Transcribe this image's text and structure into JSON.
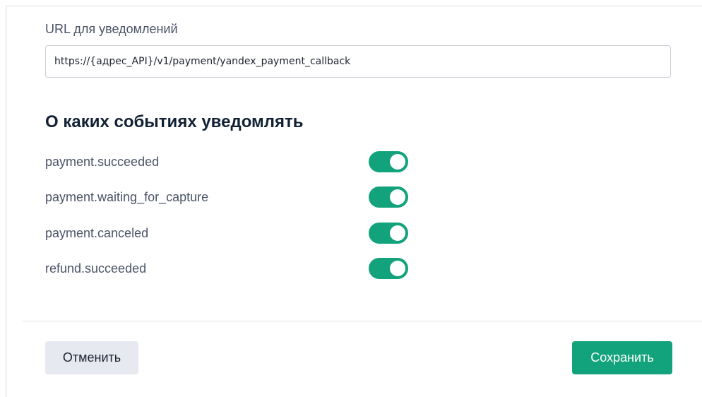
{
  "url": {
    "label": "URL для уведомлений",
    "value": "https://{адрес_API}/v1/payment/yandex_payment_callback"
  },
  "events": {
    "title": "О каких событиях уведомлять",
    "items": [
      {
        "label": "payment.succeeded",
        "enabled": true
      },
      {
        "label": "payment.waiting_for_capture",
        "enabled": true
      },
      {
        "label": "payment.canceled",
        "enabled": true
      },
      {
        "label": "refund.succeeded",
        "enabled": true
      }
    ]
  },
  "actions": {
    "cancel_label": "Отменить",
    "save_label": "Сохранить"
  },
  "colors": {
    "accent": "#13a37c",
    "title": "#122135",
    "text": "#4a5466",
    "cancel_bg": "#e6e9f0"
  }
}
